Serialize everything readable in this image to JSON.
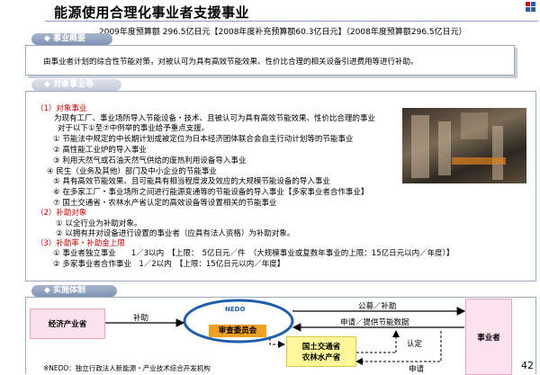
{
  "title": "能源使用合理化事业者支援事业",
  "budget": "2009年度预算额 296.5亿日元【2008年度补充预算额60.3亿日元】（2008年度预算额296.5亿日元）",
  "tabs": {
    "summary": "事业概要",
    "target": "对象事业等",
    "impl": "实施体制"
  },
  "summary_text": "由事业者计划的综合性节能对策，对被认可为具有高效节能效果、性价比合理的相关设备引进费用等进行补助。",
  "target": {
    "s1_heading": "（1）对象事业",
    "s1_line1": "为现有工厂、事业场所导入节能设备・技术、且被认可为具有高效节能效果、性价比合理的事业",
    "s1_line2": "对于以下①至⑦中例举的事业给予重点支援。",
    "items1": [
      "① 节能法中规定的中长期计划或被定位为日本经济团体联合会自主行动计划等的节能事业",
      "② 高性能工业炉的导入事业",
      "③ 利用天然气或石油天然气供给的废热利用设备导入事业",
      "④ 民生（业务及其他）部门及中小企业的节能事业",
      "⑤ 具有高效节能效果、且可能具有相当程度波及效应的大规模节能设备的导入事业",
      "⑥ 在多家工厂・事业场所之间进行能源变通等的节能设备的导入事业【多家事业者合作事业】",
      "⑦ 国土交通省・农林水产省认定的高效设备等设置相关的节能事业"
    ],
    "s2_heading": "（2）补助对象",
    "items2": [
      "① 以全行业为补助对象。",
      "② 以拥有并对设备进行设置的事业者（应具有法人资格）为补助对象。"
    ],
    "s3_heading": "（3）补助率・补助金上限",
    "items3": [
      "① 事业者独立事业　　1／3以内　【上限：　5亿日元／件　（大规模事业或复数年事业的上限：15亿日元以内／年度）】",
      "② 多家事业者合作事业　1／2以内　【上限：15亿日元以内／年度】"
    ]
  },
  "diagram": {
    "meti": "经济产业省",
    "subsidy": "补助",
    "nedo": "NEDO",
    "committee": "审查委员会",
    "public_offer": "公募／补助",
    "apply": "申请／提供节能数据",
    "operator": "事业者",
    "ministries_line1": "国土交通省",
    "ministries_line2": "农林水产省",
    "certify": "认定",
    "apply2": "申请"
  },
  "footnote": "※NEDO：独立行政法人新能源・产业技术综合开发机构",
  "page_number": "42",
  "colors": {
    "tab": "#7f93b3",
    "section_red": "#cc0000",
    "pink_box": "#fde2ee",
    "nedo_blue": "#1f5fae",
    "committee_orange": "#f0a020",
    "ministry_yellow": "#fff79a"
  }
}
